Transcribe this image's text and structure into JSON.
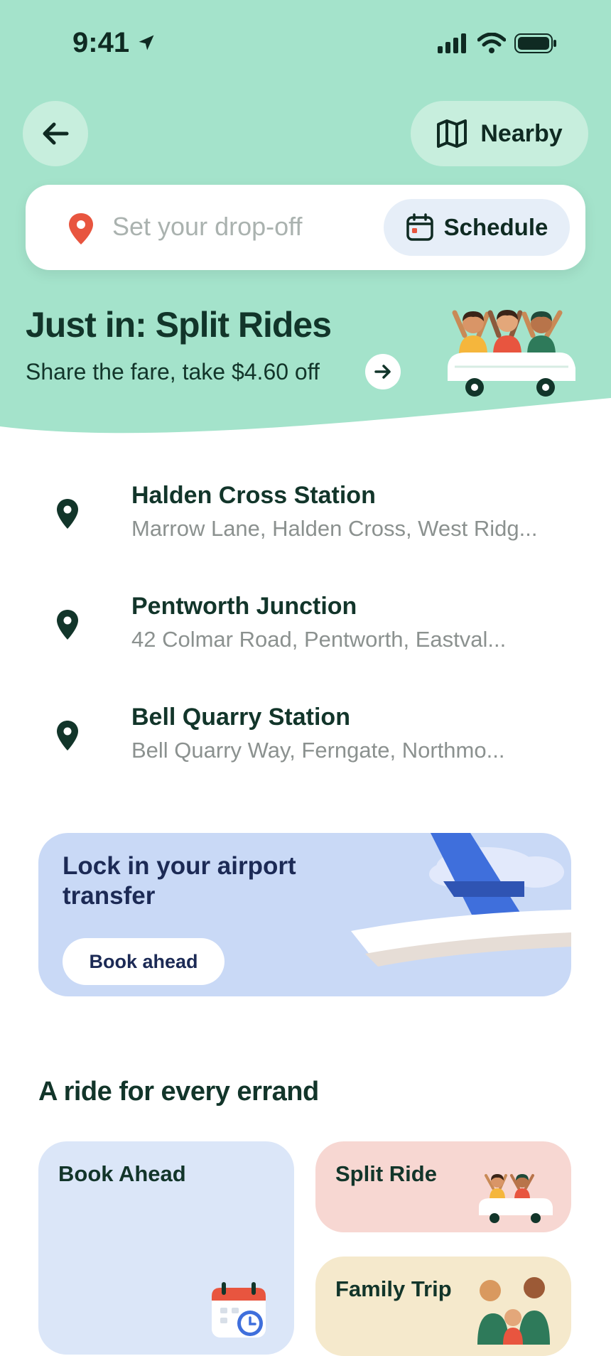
{
  "status_bar": {
    "time": "9:41"
  },
  "header": {
    "back_icon": "arrow-left-icon",
    "nearby_label": "Nearby",
    "nearby_icon": "map-icon"
  },
  "search": {
    "placeholder": "Set your drop-off",
    "pin_icon": "location-pin-icon",
    "schedule_label": "Schedule",
    "schedule_icon": "calendar-icon"
  },
  "promo": {
    "title": "Just in: Split Rides",
    "subtitle": "Share the fare, take $4.60 off"
  },
  "locations": [
    {
      "name": "Halden Cross Station",
      "address": "Marrow Lane, Halden Cross, West Ridg..."
    },
    {
      "name": "Pentworth Junction",
      "address": "42 Colmar Road, Pentworth, Eastval..."
    },
    {
      "name": "Bell Quarry Station",
      "address": "Bell Quarry Way, Ferngate, Northmo..."
    }
  ],
  "airport": {
    "title": "Lock in your airport transfer",
    "button": "Book ahead"
  },
  "section": {
    "title": "A ride for every errand",
    "cards": [
      {
        "label": "Book Ahead"
      },
      {
        "label": "Split Ride"
      },
      {
        "label": "Family Trip"
      }
    ]
  },
  "colors": {
    "hero_bg": "#a4e3cb",
    "accent_red": "#e8553f",
    "text_dark": "#12352a"
  }
}
